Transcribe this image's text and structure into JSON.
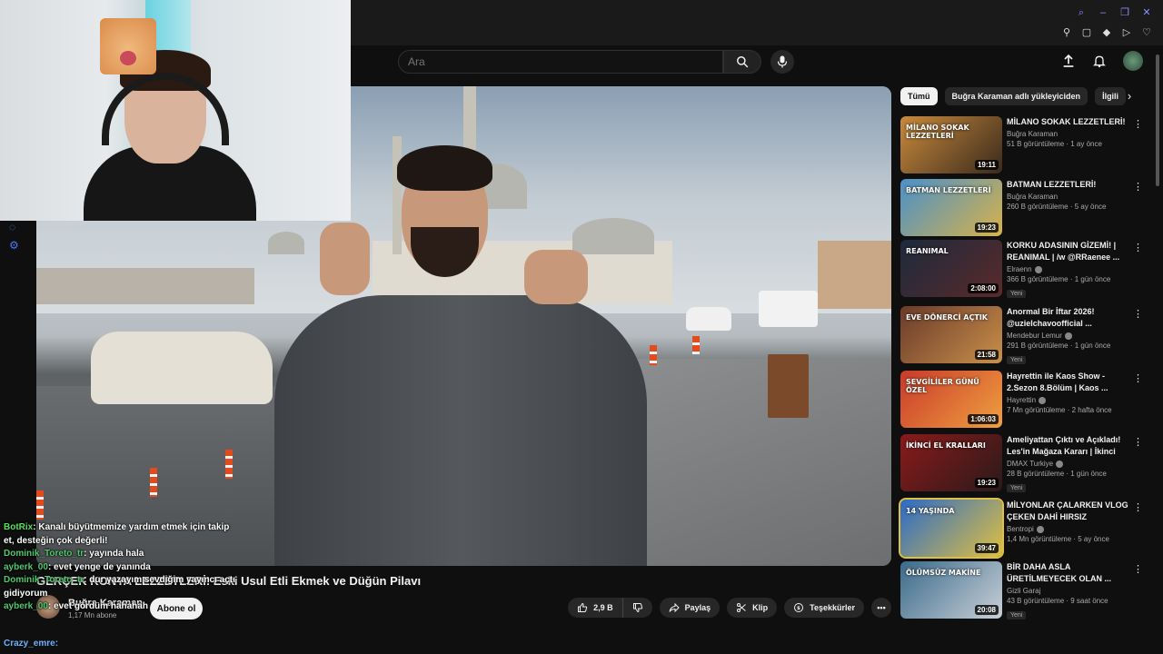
{
  "search": {
    "placeholder": "Ara"
  },
  "video": {
    "title": "GERÇEK KONYA LEZZETLERİ! Eski Usul Etli Ekmek ve Düğün Pilavı",
    "channel": "Buğra Karaman",
    "subscribers": "1,17 Mn abone",
    "subscribe_label": "Abone ol",
    "likes": "2,9 B",
    "share_label": "Paylaş",
    "clip_label": "Klip",
    "thanks_label": "Teşekkürler"
  },
  "chips": [
    "Tümü",
    "Buğra Karaman adlı yükleyiciden",
    "İlgili"
  ],
  "recommendations": [
    {
      "title": "MİLANO SOKAK LEZZETLERİ!",
      "channel": "Buğra Karaman",
      "meta": "51 B görüntüleme · 1 ay önce",
      "duration": "19:11",
      "badge": "",
      "verified": false,
      "thumb_text": "MİLANO SOKAK LEZZETLERİ",
      "colors": [
        "#c98a3c",
        "#3a2a1c"
      ]
    },
    {
      "title": "BATMAN LEZZETLERİ!",
      "channel": "Buğra Karaman",
      "meta": "260 B görüntüleme · 5 ay önce",
      "duration": "19:23",
      "badge": "",
      "verified": false,
      "thumb_text": "BATMAN LEZZETLERİ",
      "colors": [
        "#4a90c9",
        "#d8b24a"
      ]
    },
    {
      "title": "KORKU ADASININ GİZEMİ! | REANIMAL | /w @RRaenee ...",
      "channel": "Elraenn",
      "meta": "366 B görüntüleme · 1 gün önce",
      "duration": "2:08:00",
      "badge": "Yeni",
      "verified": true,
      "thumb_text": "REANIMAL",
      "colors": [
        "#1c2a3c",
        "#5a2a2a"
      ]
    },
    {
      "title": "Anormal Bir İftar 2026! @uzielchavoofficial ...",
      "channel": "Mendebur Lemur",
      "meta": "291 B görüntüleme · 1 gün önce",
      "duration": "21:58",
      "badge": "Yeni",
      "verified": true,
      "thumb_text": "EVE DÖNERCİ AÇTIK",
      "colors": [
        "#6a3a2a",
        "#c9904a"
      ]
    },
    {
      "title": "Hayrettin ile Kaos Show - 2.Sezon 8.Bölüm | Kaos ...",
      "channel": "Hayrettin",
      "meta": "7 Mn görüntüleme · 2 hafta önce",
      "duration": "1:06:03",
      "badge": "",
      "verified": true,
      "thumb_text": "SEVGİLİLER GÜNÜ ÖZEL",
      "colors": [
        "#c93a2a",
        "#f0a040"
      ]
    },
    {
      "title": "Ameliyattan Çıktı ve Açıkladı! Les'in Mağaza Kararı | İkinci El...",
      "channel": "DMAX Turkiye",
      "meta": "28 B görüntüleme · 1 gün önce",
      "duration": "19:23",
      "badge": "Yeni",
      "verified": true,
      "thumb_text": "İKİNCİ EL KRALLARI",
      "colors": [
        "#8a1a1a",
        "#2a1a1a"
      ]
    },
    {
      "title": "MİLYONLAR ÇALARKEN VLOG ÇEKEN DAHİ HIRSIZ",
      "channel": "Bentropi",
      "meta": "1,4 Mn görüntüleme · 5 ay önce",
      "duration": "39:47",
      "badge": "",
      "verified": true,
      "thumb_text": "14 YAŞINDA",
      "colors": [
        "#2a6ac9",
        "#e0c040"
      ]
    },
    {
      "title": "BİR DAHA ASLA ÜRETİLMEYECEK OLAN ...",
      "channel": "Gizli Garaj",
      "meta": "43 B görüntüleme · 9 saat önce",
      "duration": "20:08",
      "badge": "Yeni",
      "verified": false,
      "thumb_text": "ÖLÜMSÜZ MAKİNE",
      "colors": [
        "#3a6a8a",
        "#c9d0d8"
      ]
    }
  ],
  "chat": [
    {
      "user": "BotRix",
      "color": "#58e05b",
      "text": "Kanalı büyütmemize yardım etmek için takip"
    },
    {
      "user": "",
      "color": "#ffffff",
      "text": "et, desteğin çok değerli!"
    },
    {
      "user": "Dominik_Toreto_tr",
      "color": "#4ec96d",
      "text": "yayında hala"
    },
    {
      "user": "ayberk_00",
      "color": "#4ec96d",
      "text": "evet yenge de yanında"
    },
    {
      "user": "Dominik_Toreto_tr",
      "color": "#4ec96d",
      "text": "dur yazayım sevdiğim yayıncı açtı"
    },
    {
      "user": "",
      "color": "#ffffff",
      "text": "gidiyorum"
    },
    {
      "user": "ayberk_00",
      "color": "#4ec96d",
      "text": "evet gördüm hahahah"
    }
  ],
  "chat_last_user": "Crazy_emre:"
}
